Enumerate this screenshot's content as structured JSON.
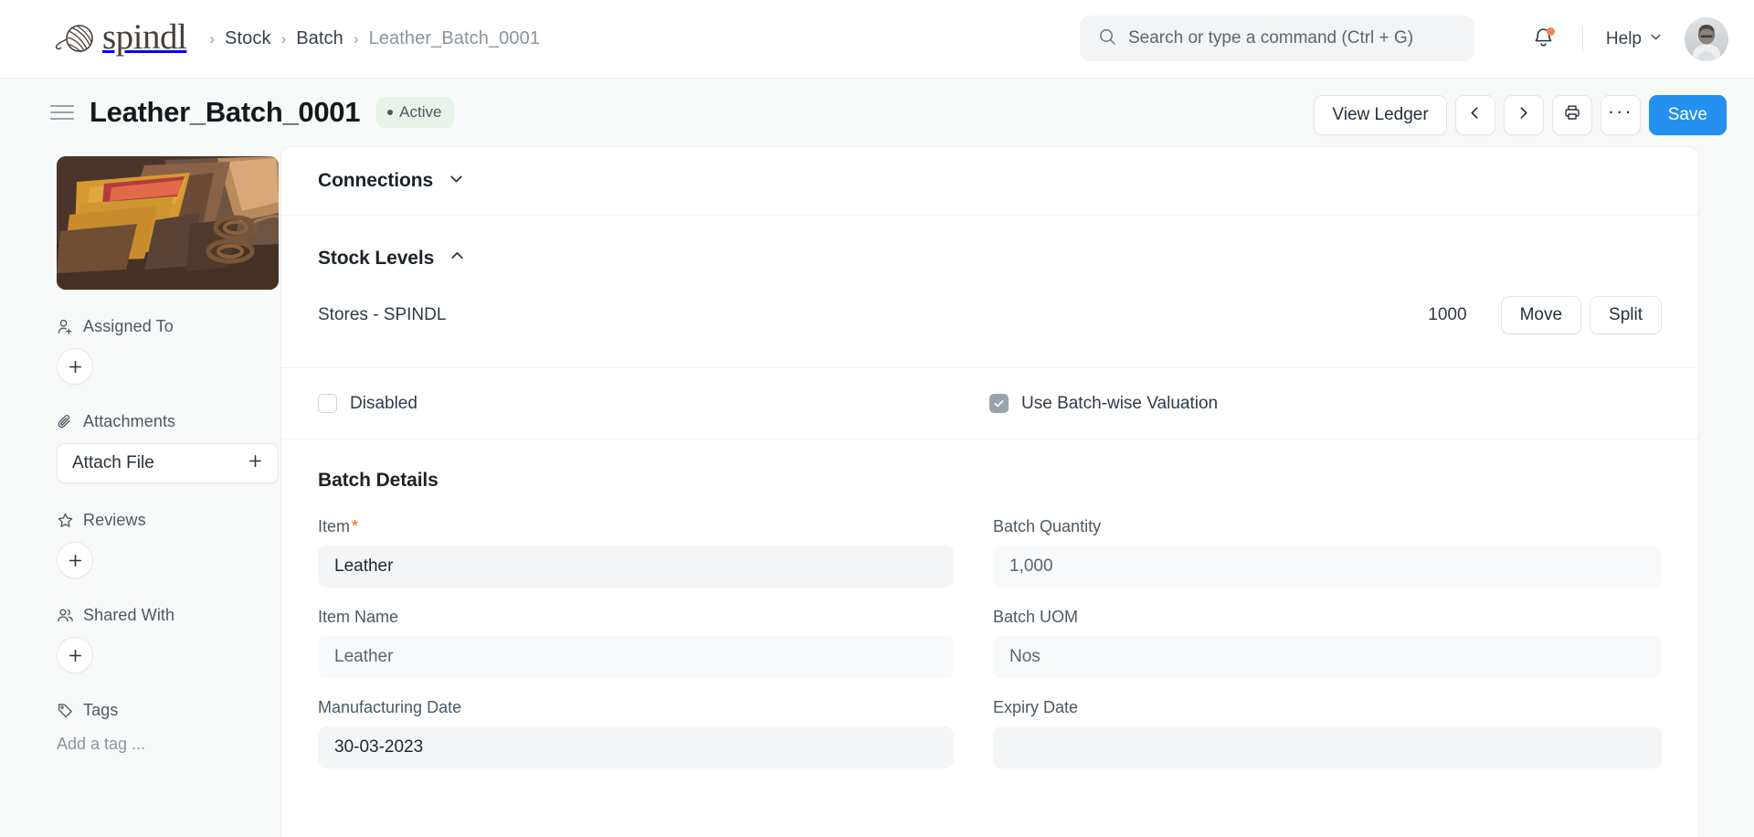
{
  "navbar": {
    "brand": "spindl",
    "brand_icon": "yarn-ball-icon",
    "breadcrumbs": [
      {
        "label": "Stock"
      },
      {
        "label": "Batch"
      },
      {
        "label": "Leather_Batch_0001"
      }
    ],
    "search": {
      "placeholder": "Search or type a command (Ctrl + G)",
      "value": "",
      "icon": "search-icon"
    },
    "notifications": {
      "icon": "bell-icon",
      "has_unread": true,
      "dot_color": "#f8814f"
    },
    "help": {
      "label": "Help",
      "icon": "chevron-down-icon"
    },
    "avatar": {
      "icon": "user-avatar"
    }
  },
  "titlebar": {
    "menu_icon": "hamburger-menu-icon",
    "title": "Leather_Batch_0001",
    "status": "Active",
    "status_bg": "#e8f3ea",
    "actions": {
      "view_ledger": "View Ledger",
      "prev_icon": "chevron-left-icon",
      "next_icon": "chevron-right-icon",
      "print_icon": "printer-icon",
      "more_icon": "ellipsis-icon",
      "more_label": "···",
      "save": "Save",
      "save_color": "#2490ef"
    }
  },
  "sidebar": {
    "thumbnail": {
      "alt": "leather-pieces-photo"
    },
    "sections": [
      {
        "label": "Assigned To",
        "icon": "user-plus-icon",
        "control": "add-button",
        "control_label": "+"
      },
      {
        "label": "Attachments",
        "icon": "paperclip-icon",
        "control": "attach-file-box",
        "control_label": "Attach File",
        "control_suffix": "+"
      },
      {
        "label": "Reviews",
        "icon": "star-icon",
        "control": "add-button",
        "control_label": "+"
      },
      {
        "label": "Shared With",
        "icon": "users-icon",
        "control": "add-button",
        "control_label": "+"
      },
      {
        "label": "Tags",
        "icon": "tag-icon",
        "control": "tag-input",
        "control_label": "Add a tag ..."
      }
    ]
  },
  "main": {
    "connections": {
      "title": "Connections",
      "chevron": "chevron-down-icon",
      "expanded": false
    },
    "stock_levels": {
      "title": "Stock Levels",
      "chevron": "chevron-up-icon",
      "expanded": true,
      "rows": [
        {
          "warehouse": "Stores - SPINDL",
          "qty": "1000",
          "move": "Move",
          "split": "Split"
        }
      ]
    },
    "checkboxes": [
      {
        "label": "Disabled",
        "checked": false
      },
      {
        "label": "Use Batch-wise Valuation",
        "checked": true
      }
    ],
    "batch_details": {
      "title": "Batch Details",
      "fields_left": [
        {
          "label": "Item",
          "required": true,
          "value": "Leather",
          "readonly": false
        },
        {
          "label": "Item Name",
          "required": false,
          "value": "Leather",
          "readonly": true
        },
        {
          "label": "Manufacturing Date",
          "required": false,
          "value": "30-03-2023",
          "readonly": false
        }
      ],
      "fields_right": [
        {
          "label": "Batch Quantity",
          "required": false,
          "value": "1,000",
          "readonly": true
        },
        {
          "label": "Batch UOM",
          "required": false,
          "value": "Nos",
          "readonly": true
        },
        {
          "label": "Expiry Date",
          "required": false,
          "value": "",
          "readonly": false
        }
      ]
    }
  }
}
